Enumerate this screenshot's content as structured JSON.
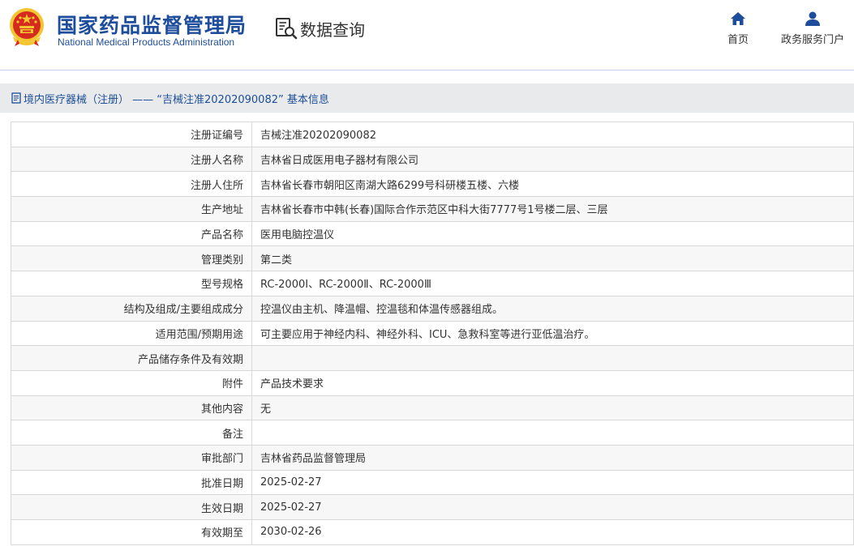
{
  "header": {
    "agency_cn": "国家药品监督管理局",
    "agency_en": "National Medical Products Administration",
    "query_label": "数据查询",
    "nav": [
      {
        "label": "首页",
        "icon": "home-icon"
      },
      {
        "label": "政务服务门户",
        "icon": "user-icon"
      }
    ]
  },
  "breadcrumb": {
    "text": "境内医疗器械（注册） ——  “吉械注准20202090082” 基本信息"
  },
  "rows": [
    {
      "label": "注册证编号",
      "value": "吉械注准20202090082"
    },
    {
      "label": "注册人名称",
      "value": "吉林省日成医用电子器材有限公司"
    },
    {
      "label": "注册人住所",
      "value": "吉林省长春市朝阳区南湖大路6299号科研楼五楼、六楼"
    },
    {
      "label": "生产地址",
      "value": "吉林省长春市中韩(长春)国际合作示范区中科大街7777号1号楼二层、三层"
    },
    {
      "label": "产品名称",
      "value": "医用电脑控温仪"
    },
    {
      "label": "管理类别",
      "value": "第二类"
    },
    {
      "label": "型号规格",
      "value": "RC-2000Ⅰ、RC-2000Ⅱ、RC-2000Ⅲ"
    },
    {
      "label": "结构及组成/主要组成成分",
      "value": "控温仪由主机、降温帽、控温毯和体温传感器组成。"
    },
    {
      "label": "适用范围/预期用途",
      "value": "可主要应用于神经内科、神经外科、ICU、急救科室等进行亚低温治疗。"
    },
    {
      "label": "产品储存条件及有效期",
      "value": ""
    },
    {
      "label": "附件",
      "value": "产品技术要求"
    },
    {
      "label": "其他内容",
      "value": "无"
    },
    {
      "label": "备注",
      "value": ""
    },
    {
      "label": "审批部门",
      "value": "吉林省药品监督管理局"
    },
    {
      "label": "批准日期",
      "value": "2025-02-27"
    },
    {
      "label": "生效日期",
      "value": "2025-02-27"
    },
    {
      "label": "有效期至",
      "value": "2030-02-26"
    }
  ],
  "colors": {
    "brand_blue": "#1e4d9b",
    "crumb_bg": "#e9eaec",
    "emblem_red": "#d52b1e",
    "emblem_gold": "#f3c530"
  }
}
